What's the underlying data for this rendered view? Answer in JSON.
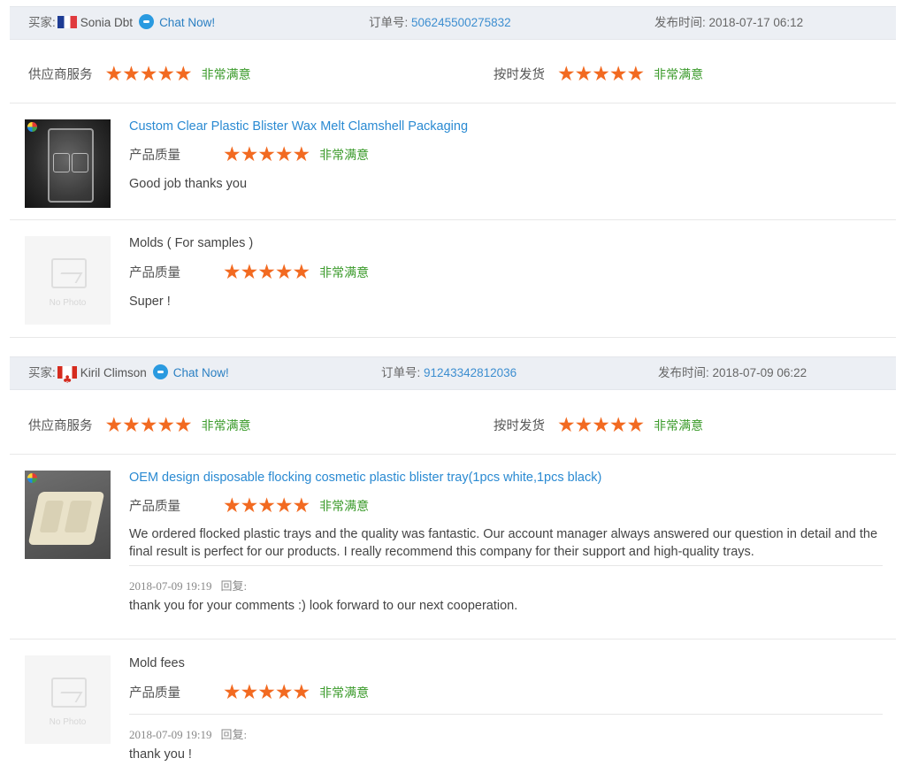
{
  "labels": {
    "buyer": "买家:",
    "order_no": "订单号:",
    "published": "发布时间:",
    "supplier_service": "供应商服务",
    "on_time_delivery": "按时发货",
    "product_quality": "产品质量",
    "satisfaction": "非常满意",
    "chat_now": "Chat Now!",
    "reply": "回复:",
    "no_photo": "No Photo"
  },
  "colors": {
    "star": "#f26a21",
    "satisfaction": "#3a9a2a",
    "link": "#2a8ad2",
    "header_bg": "#eceff4"
  },
  "orders": [
    {
      "buyer_name": "Sonia Dbt",
      "country_flag": "france-flag",
      "order_no": "506245500275832",
      "publish_time": "2018-07-17 06:12",
      "supplier_service_stars": 5,
      "on_time_delivery_stars": 5,
      "products": [
        {
          "title": "Custom Clear Plastic Blister Wax Melt Clamshell Packaging",
          "quality_stars": 5,
          "comment": "Good job thanks you",
          "image": "clear-clamshell-photo"
        },
        {
          "title": "Molds ( For samples )",
          "quality_stars": 5,
          "comment": "Super !",
          "image": "no-photo"
        }
      ]
    },
    {
      "buyer_name": "Kiril Climson",
      "country_flag": "canada-flag",
      "order_no": "91243342812036",
      "publish_time": "2018-07-09 06:22",
      "supplier_service_stars": 5,
      "on_time_delivery_stars": 5,
      "products": [
        {
          "title": "OEM design disposable flocking cosmetic plastic blister tray(1pcs white,1pcs black)",
          "quality_stars": 5,
          "comment": "We ordered flocked plastic trays and the quality was fantastic. Our account manager always answered our question in detail and the final result is perfect for our products. I really recommend this company for their support and high-quality trays.",
          "image": "flocked-tray-photo",
          "reply": {
            "time": "2018-07-09 19:19",
            "text": "thank you for your comments :) look forward to our next cooperation."
          }
        },
        {
          "title": "Mold fees",
          "quality_stars": 5,
          "comment": "",
          "image": "no-photo",
          "reply": {
            "time": "2018-07-09 19:19",
            "text": "thank you !"
          }
        }
      ]
    }
  ]
}
